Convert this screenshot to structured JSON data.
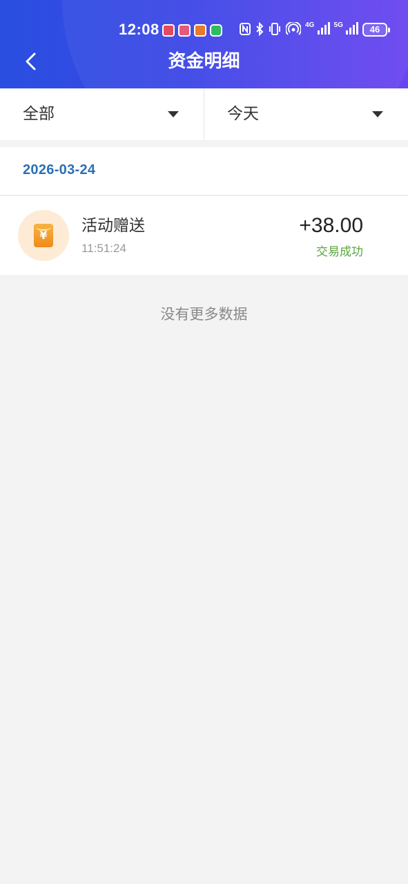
{
  "status_bar": {
    "time": "12:08",
    "notification_icons": [
      "book-app-icon",
      "book-app-icon",
      "video-app-icon",
      "wechat-icon"
    ],
    "system_icons": [
      "nfc-icon",
      "bluetooth-icon",
      "vibrate-icon",
      "hotspot-icon",
      "signal-4g-icon",
      "signal-5g-icon"
    ],
    "network_4g": "4G",
    "network_5g": "5G",
    "battery": "46"
  },
  "header": {
    "title": "资金明细",
    "back_icon": "chevron-left-icon"
  },
  "filters": [
    {
      "label": "全部",
      "icon": "caret-down-icon"
    },
    {
      "label": "今天",
      "icon": "caret-down-icon"
    }
  ],
  "date_group": "2026-03-24",
  "records": [
    {
      "icon": "red-envelope-yuan-icon",
      "icon_glyph": "¥",
      "title": "活动赠送",
      "time": "11:51:24",
      "amount": "+38.00",
      "status": "交易成功"
    }
  ],
  "footer": {
    "no_more": "没有更多数据"
  },
  "colors": {
    "header_gradient_start": "#2a4fe0",
    "header_gradient_end": "#6a44f0",
    "date_text": "#2a6fb5",
    "status_success": "#5aa63e",
    "page_background": "#f3f3f3"
  }
}
